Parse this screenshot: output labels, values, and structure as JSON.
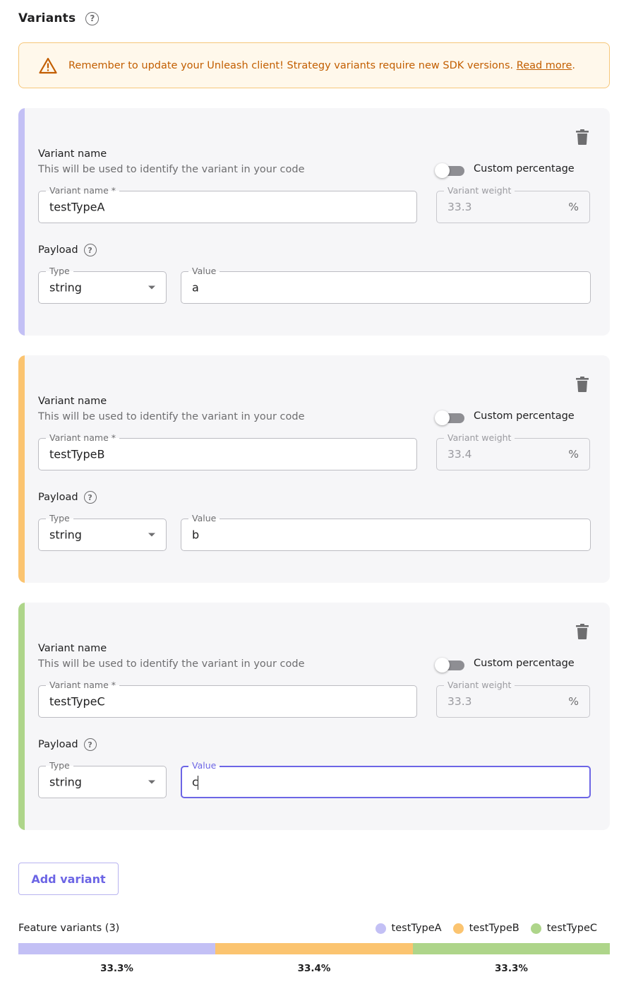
{
  "header": {
    "title": "Variants",
    "help_icon": "?"
  },
  "alert": {
    "icon": "warning-triangle-icon",
    "text": "Remember to update your Unleash client! Strategy variants require new SDK versions. ",
    "link": "Read more",
    "suffix": "."
  },
  "colors": {
    "primary": "#6c65e5",
    "variantA": "#c3c0f5",
    "variantB": "#fbc470",
    "variantC": "#aed58a"
  },
  "variants": [
    {
      "stripe_color": "#c3c0f5",
      "name_label": "Variant name",
      "name_description": "This will be used to identify the variant in your code",
      "custom_percentage_label": "Custom percentage",
      "name_field_legend": "Variant name *",
      "name_value": "testTypeA",
      "weight_legend": "Variant weight",
      "weight_value": "33.3",
      "weight_suffix": "%",
      "payload_label": "Payload",
      "type_legend": "Type",
      "type_value": "string",
      "value_legend": "Value",
      "value": "a"
    },
    {
      "stripe_color": "#fbc470",
      "name_label": "Variant name",
      "name_description": "This will be used to identify the variant in your code",
      "custom_percentage_label": "Custom percentage",
      "name_field_legend": "Variant name *",
      "name_value": "testTypeB",
      "weight_legend": "Variant weight",
      "weight_value": "33.4",
      "weight_suffix": "%",
      "payload_label": "Payload",
      "type_legend": "Type",
      "type_value": "string",
      "value_legend": "Value",
      "value": "b"
    },
    {
      "stripe_color": "#aed58a",
      "name_label": "Variant name",
      "name_description": "This will be used to identify the variant in your code",
      "custom_percentage_label": "Custom percentage",
      "name_field_legend": "Variant name *",
      "name_value": "testTypeC",
      "weight_legend": "Variant weight",
      "weight_value": "33.3",
      "weight_suffix": "%",
      "payload_label": "Payload",
      "type_legend": "Type",
      "type_value": "string",
      "value_legend": "Value",
      "value": "c"
    }
  ],
  "add_variant_label": "Add variant",
  "summary": {
    "title": "Feature variants (3)",
    "segments": [
      {
        "name": "testTypeA",
        "percent": 33.3,
        "label": "33.3%",
        "color": "#c3c0f5"
      },
      {
        "name": "testTypeB",
        "percent": 33.4,
        "label": "33.4%",
        "color": "#fbc470"
      },
      {
        "name": "testTypeC",
        "percent": 33.3,
        "label": "33.3%",
        "color": "#aed58a"
      }
    ]
  }
}
